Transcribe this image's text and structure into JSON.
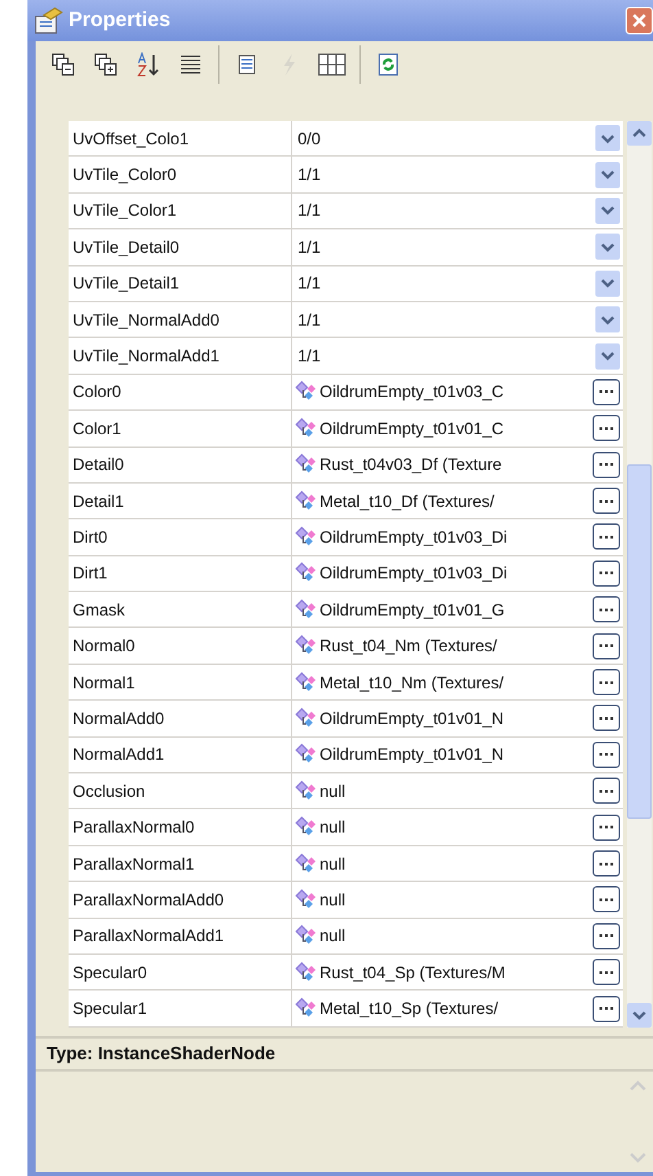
{
  "window": {
    "title": "Properties"
  },
  "toolbar": {
    "groups": [
      [
        {
          "kind": "collapse",
          "disabled": false
        },
        {
          "kind": "expand",
          "disabled": false
        },
        {
          "kind": "sort-alpha",
          "disabled": false
        },
        {
          "kind": "list",
          "disabled": false
        }
      ],
      [
        {
          "kind": "properties",
          "disabled": false
        },
        {
          "kind": "events",
          "disabled": true
        },
        {
          "kind": "grid",
          "disabled": false
        }
      ],
      [
        {
          "kind": "refresh",
          "disabled": false
        }
      ]
    ]
  },
  "rows": [
    {
      "name": "UvOffset_Colo1",
      "value": "0/0",
      "kind": "dropdown"
    },
    {
      "name": "UvTile_Color0",
      "value": "1/1",
      "kind": "dropdown"
    },
    {
      "name": "UvTile_Color1",
      "value": "1/1",
      "kind": "dropdown"
    },
    {
      "name": "UvTile_Detail0",
      "value": "1/1",
      "kind": "dropdown"
    },
    {
      "name": "UvTile_Detail1",
      "value": "1/1",
      "kind": "dropdown"
    },
    {
      "name": "UvTile_NormalAdd0",
      "value": "1/1",
      "kind": "dropdown"
    },
    {
      "name": "UvTile_NormalAdd1",
      "value": "1/1",
      "kind": "dropdown"
    },
    {
      "name": "Color0",
      "value": "OildrumEmpty_t01v03_C",
      "kind": "texture"
    },
    {
      "name": "Color1",
      "value": "OildrumEmpty_t01v01_C",
      "kind": "texture"
    },
    {
      "name": "Detail0",
      "value": "Rust_t04v03_Df (Texture",
      "kind": "texture"
    },
    {
      "name": "Detail1",
      "value": "Metal_t10_Df (Textures/",
      "kind": "texture"
    },
    {
      "name": "Dirt0",
      "value": "OildrumEmpty_t01v03_Di",
      "kind": "texture"
    },
    {
      "name": "Dirt1",
      "value": "OildrumEmpty_t01v03_Di",
      "kind": "texture"
    },
    {
      "name": "Gmask",
      "value": "OildrumEmpty_t01v01_G",
      "kind": "texture"
    },
    {
      "name": "Normal0",
      "value": "Rust_t04_Nm (Textures/",
      "kind": "texture"
    },
    {
      "name": "Normal1",
      "value": "Metal_t10_Nm (Textures/",
      "kind": "texture"
    },
    {
      "name": "NormalAdd0",
      "value": "OildrumEmpty_t01v01_N",
      "kind": "texture"
    },
    {
      "name": "NormalAdd1",
      "value": "OildrumEmpty_t01v01_N",
      "kind": "texture"
    },
    {
      "name": "Occlusion",
      "value": "null",
      "kind": "texture"
    },
    {
      "name": "ParallaxNormal0",
      "value": "null",
      "kind": "texture"
    },
    {
      "name": "ParallaxNormal1",
      "value": "null",
      "kind": "texture"
    },
    {
      "name": "ParallaxNormalAdd0",
      "value": "null",
      "kind": "texture"
    },
    {
      "name": "ParallaxNormalAdd1",
      "value": "null",
      "kind": "texture"
    },
    {
      "name": "Specular0",
      "value": "Rust_t04_Sp (Textures/M",
      "kind": "texture"
    },
    {
      "name": "Specular1",
      "value": "Metal_t10_Sp (Textures/",
      "kind": "texture"
    }
  ],
  "description": {
    "title": "Type: InstanceShaderNode"
  }
}
